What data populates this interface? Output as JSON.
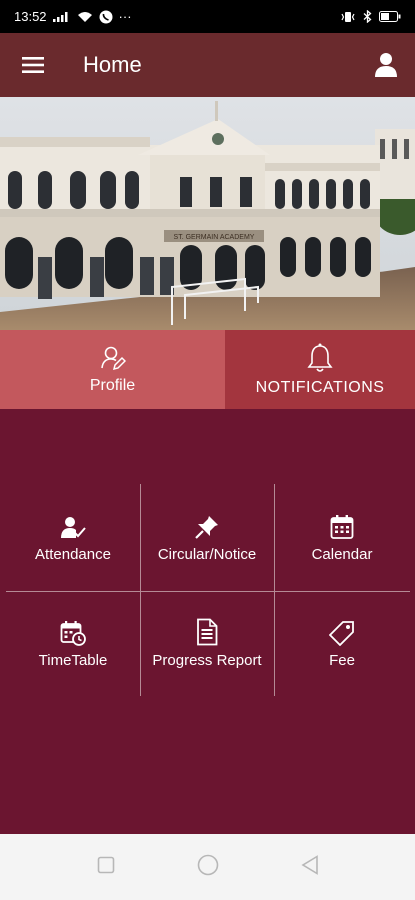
{
  "status": {
    "time": "13:52",
    "more": "···"
  },
  "header": {
    "title": "Home"
  },
  "hero": {
    "school_sign": "ST. GERMAIN ACADEMY"
  },
  "tabs": [
    {
      "label": "Profile",
      "icon": "profile-edit-icon"
    },
    {
      "label": "NOTIFICATIONS",
      "icon": "bell-icon"
    }
  ],
  "menu": [
    {
      "label": "Attendance",
      "icon": "attendance-icon"
    },
    {
      "label": "Circular/Notice",
      "icon": "pushpin-icon"
    },
    {
      "label": "Calendar",
      "icon": "calendar-icon"
    },
    {
      "label": "TimeTable",
      "icon": "timetable-icon"
    },
    {
      "label": "Progress Report",
      "icon": "document-icon"
    },
    {
      "label": "Fee",
      "icon": "tag-icon"
    }
  ],
  "colors": {
    "app_bar": "#6a2a2d",
    "tab_profile": "#c3585d",
    "tab_notifications": "#a3353e",
    "background": "#6b1530"
  }
}
